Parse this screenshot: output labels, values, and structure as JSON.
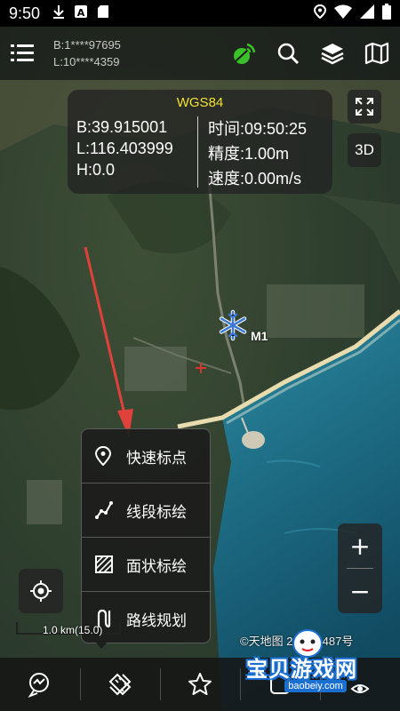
{
  "status_bar": {
    "time": "9:50",
    "icons": [
      "download-icon",
      "a-badge-icon",
      "sd-card-icon",
      "location-icon",
      "wifi-icon",
      "signal-icon",
      "battery-icon"
    ]
  },
  "toolbar": {
    "coord_b": "B:1****97695",
    "coord_l": "L:10****4359",
    "icons": [
      "menu-icon",
      "gps-signal-icon",
      "search-icon",
      "layers-icon",
      "map-icon"
    ]
  },
  "info_panel": {
    "crs": "WGS84",
    "lat": "B:39.915001",
    "lon": "L:116.403999",
    "height": "H:0.0",
    "time": "时间:09:50:25",
    "accuracy": "精度:1.00m",
    "speed": "速度:0.00m/s"
  },
  "buttons": {
    "mode_3d": "3D",
    "zoom_in": "+",
    "zoom_out": "−"
  },
  "marker": {
    "label": "M1",
    "icon": "snowflake-marker-icon"
  },
  "popup_menu": {
    "items": [
      {
        "label": "快速标点",
        "icon": "pin-icon"
      },
      {
        "label": "线段标绘",
        "icon": "polyline-icon"
      },
      {
        "label": "面状标绘",
        "icon": "polygon-icon"
      },
      {
        "label": "路线规划",
        "icon": "route-icon"
      }
    ]
  },
  "map_footer": {
    "scale": "1.0 km(15.0)",
    "copyright": "©天地图 2021)1487号"
  },
  "bottom_bar": {
    "icons": [
      "track-icon",
      "measure-icon",
      "favorite-icon",
      "tools-icon",
      "share-icon"
    ]
  },
  "watermark": {
    "text": "宝贝游戏网",
    "url": "baobeiy.com"
  },
  "colors": {
    "crs_yellow": "#f2e232",
    "gps_green": "#3bbf2a",
    "arrow_red": "#e0413a",
    "sea": "#1f6f86",
    "land": "#30412f"
  }
}
